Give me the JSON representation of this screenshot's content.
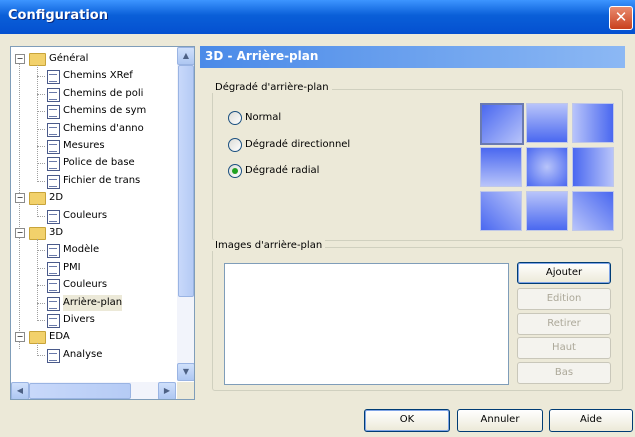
{
  "window": {
    "title": "Configuration",
    "close_glyph": "✕"
  },
  "tree": {
    "items": [
      {
        "label": "Général",
        "level": 0,
        "type": "folder",
        "expanded": true
      },
      {
        "label": "Chemins XRef",
        "level": 1,
        "type": "doc"
      },
      {
        "label": "Chemins de poli",
        "level": 1,
        "type": "doc"
      },
      {
        "label": "Chemins de sym",
        "level": 1,
        "type": "doc"
      },
      {
        "label": "Chemins d'anno",
        "level": 1,
        "type": "doc"
      },
      {
        "label": "Mesures",
        "level": 1,
        "type": "doc"
      },
      {
        "label": "Police de base",
        "level": 1,
        "type": "doc"
      },
      {
        "label": "Fichier de trans",
        "level": 1,
        "type": "doc"
      },
      {
        "label": "2D",
        "level": 0,
        "type": "folder",
        "expanded": true
      },
      {
        "label": "Couleurs",
        "level": 1,
        "type": "doc"
      },
      {
        "label": "3D",
        "level": 0,
        "type": "folder",
        "expanded": true
      },
      {
        "label": "Modèle",
        "level": 1,
        "type": "doc"
      },
      {
        "label": "PMI",
        "level": 1,
        "type": "doc"
      },
      {
        "label": "Couleurs",
        "level": 1,
        "type": "doc"
      },
      {
        "label": "Arrière-plan",
        "level": 1,
        "type": "doc",
        "selected": true
      },
      {
        "label": "Divers",
        "level": 1,
        "type": "doc"
      },
      {
        "label": "EDA",
        "level": 0,
        "type": "folder",
        "expanded": true
      },
      {
        "label": "Analyse",
        "level": 1,
        "type": "doc"
      }
    ],
    "expand_glyph": "−",
    "scroll_up": "▲",
    "scroll_down": "▼",
    "scroll_left": "◀",
    "scroll_right": "▶"
  },
  "panel": {
    "title": "3D - Arrière-plan",
    "gradient_group": {
      "label": "Dégradé d'arrière-plan",
      "options": [
        {
          "label": "Normal",
          "checked": false
        },
        {
          "label": "Dégradé directionnel",
          "checked": false
        },
        {
          "label": "Dégradé radial",
          "checked": true
        }
      ]
    },
    "images_group": {
      "label": "Images d'arrière-plan"
    },
    "buttons": {
      "add": "Ajouter",
      "edit": "Edition",
      "remove": "Retirer",
      "up": "Haut",
      "down": "Bas"
    }
  },
  "footer": {
    "ok": "OK",
    "cancel": "Annuler",
    "help": "Aide"
  },
  "colors": {
    "accent": "#0a5fd8",
    "swatch_light": "#b8c4fa",
    "swatch_dark": "#4a68f0"
  }
}
